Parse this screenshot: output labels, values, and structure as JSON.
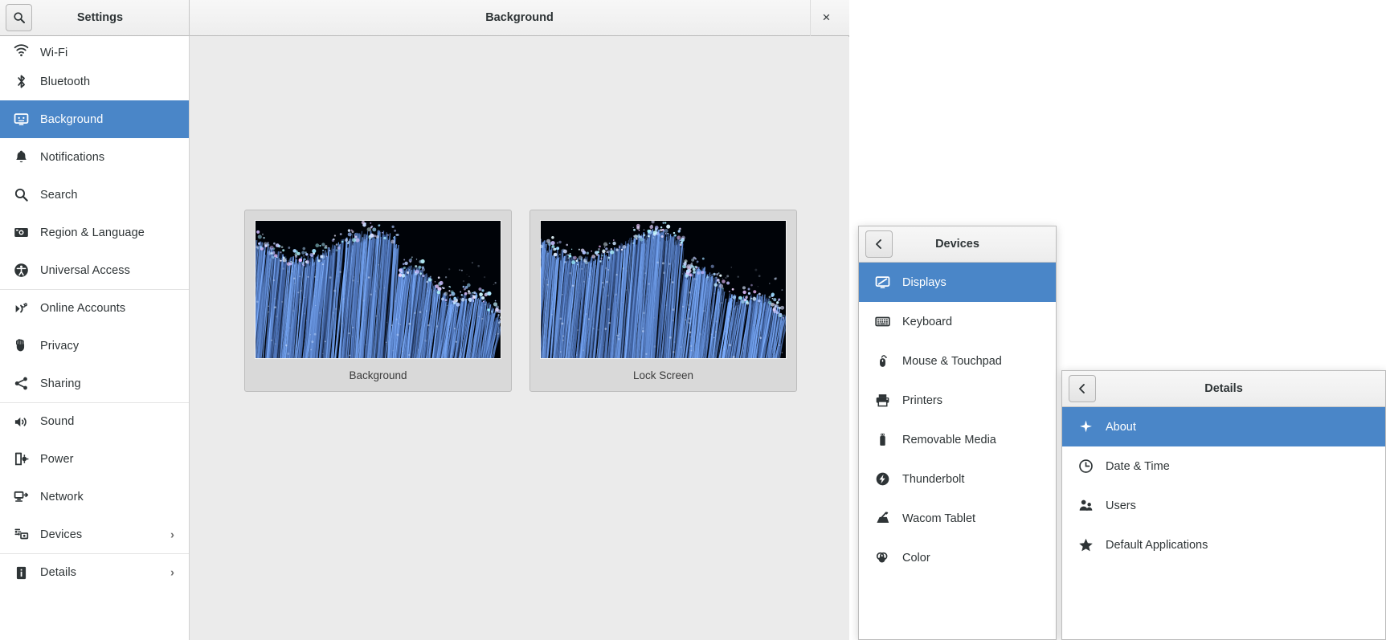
{
  "window": {
    "left_title": "Settings",
    "title": "Background",
    "close_label": "×",
    "search_icon": "search-icon",
    "close_icon": "close-icon"
  },
  "colors": {
    "accent": "#4a86c8",
    "headerbar": "#f2f2f2",
    "content_bg": "#ebebeb",
    "sidebar_bg": "#ffffff",
    "text": "#2e3436"
  },
  "sidebar": {
    "items": [
      {
        "label": "Wi-Fi",
        "icon": "wifi-icon",
        "selected": false,
        "chevron": false,
        "separator": false
      },
      {
        "label": "Bluetooth",
        "icon": "bluetooth-icon",
        "selected": false,
        "chevron": false,
        "separator": false
      },
      {
        "label": "Background",
        "icon": "background-icon",
        "selected": true,
        "chevron": false,
        "separator": false
      },
      {
        "label": "Notifications",
        "icon": "bell-icon",
        "selected": false,
        "chevron": false,
        "separator": false
      },
      {
        "label": "Search",
        "icon": "search-icon",
        "selected": false,
        "chevron": false,
        "separator": false
      },
      {
        "label": "Region & Language",
        "icon": "region-language-icon",
        "selected": false,
        "chevron": false,
        "separator": false
      },
      {
        "label": "Universal Access",
        "icon": "universal-access-icon",
        "selected": false,
        "chevron": false,
        "separator": false
      },
      {
        "label": "Online Accounts",
        "icon": "online-accounts-icon",
        "selected": false,
        "chevron": false,
        "separator": true
      },
      {
        "label": "Privacy",
        "icon": "privacy-hand-icon",
        "selected": false,
        "chevron": false,
        "separator": false
      },
      {
        "label": "Sharing",
        "icon": "sharing-icon",
        "selected": false,
        "chevron": false,
        "separator": false
      },
      {
        "label": "Sound",
        "icon": "sound-icon",
        "selected": false,
        "chevron": false,
        "separator": true
      },
      {
        "label": "Power",
        "icon": "power-icon",
        "selected": false,
        "chevron": false,
        "separator": false
      },
      {
        "label": "Network",
        "icon": "network-icon",
        "selected": false,
        "chevron": false,
        "separator": false
      },
      {
        "label": "Devices",
        "icon": "devices-icon",
        "selected": false,
        "chevron": true,
        "separator": false
      },
      {
        "label": "Details",
        "icon": "details-info-icon",
        "selected": false,
        "chevron": true,
        "separator": true
      }
    ]
  },
  "main": {
    "wallpapers": [
      {
        "caption": "Background",
        "name": "background-wallpaper-card"
      },
      {
        "caption": "Lock Screen",
        "name": "lock-screen-wallpaper-card"
      }
    ]
  },
  "panel_devices": {
    "title": "Devices",
    "back_icon": "chevron-left-icon",
    "items": [
      {
        "label": "Displays",
        "icon": "displays-icon",
        "selected": true
      },
      {
        "label": "Keyboard",
        "icon": "keyboard-icon",
        "selected": false
      },
      {
        "label": "Mouse & Touchpad",
        "icon": "mouse-icon",
        "selected": false
      },
      {
        "label": "Printers",
        "icon": "printer-icon",
        "selected": false
      },
      {
        "label": "Removable Media",
        "icon": "usb-drive-icon",
        "selected": false
      },
      {
        "label": "Thunderbolt",
        "icon": "thunderbolt-icon",
        "selected": false
      },
      {
        "label": "Wacom Tablet",
        "icon": "wacom-tablet-icon",
        "selected": false
      },
      {
        "label": "Color",
        "icon": "color-icon",
        "selected": false
      }
    ]
  },
  "panel_details": {
    "title": "Details",
    "back_icon": "chevron-left-icon",
    "items": [
      {
        "label": "About",
        "icon": "about-star-icon",
        "selected": true
      },
      {
        "label": "Date & Time",
        "icon": "clock-icon",
        "selected": false
      },
      {
        "label": "Users",
        "icon": "users-icon",
        "selected": false
      },
      {
        "label": "Default Applications",
        "icon": "star-icon",
        "selected": false
      }
    ]
  }
}
